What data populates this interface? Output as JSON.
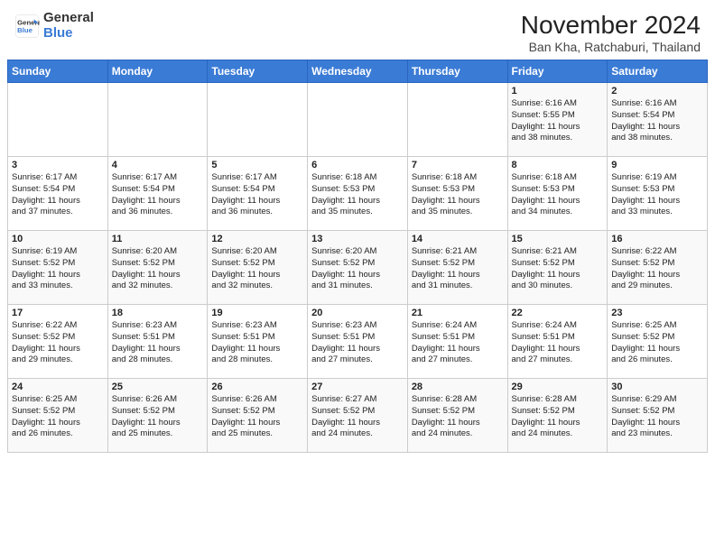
{
  "header": {
    "logo_general": "General",
    "logo_blue": "Blue",
    "month_title": "November 2024",
    "location": "Ban Kha, Ratchaburi, Thailand"
  },
  "weekdays": [
    "Sunday",
    "Monday",
    "Tuesday",
    "Wednesday",
    "Thursday",
    "Friday",
    "Saturday"
  ],
  "weeks": [
    [
      {
        "day": "",
        "info": ""
      },
      {
        "day": "",
        "info": ""
      },
      {
        "day": "",
        "info": ""
      },
      {
        "day": "",
        "info": ""
      },
      {
        "day": "",
        "info": ""
      },
      {
        "day": "1",
        "info": "Sunrise: 6:16 AM\nSunset: 5:55 PM\nDaylight: 11 hours\nand 38 minutes."
      },
      {
        "day": "2",
        "info": "Sunrise: 6:16 AM\nSunset: 5:54 PM\nDaylight: 11 hours\nand 38 minutes."
      }
    ],
    [
      {
        "day": "3",
        "info": "Sunrise: 6:17 AM\nSunset: 5:54 PM\nDaylight: 11 hours\nand 37 minutes."
      },
      {
        "day": "4",
        "info": "Sunrise: 6:17 AM\nSunset: 5:54 PM\nDaylight: 11 hours\nand 36 minutes."
      },
      {
        "day": "5",
        "info": "Sunrise: 6:17 AM\nSunset: 5:54 PM\nDaylight: 11 hours\nand 36 minutes."
      },
      {
        "day": "6",
        "info": "Sunrise: 6:18 AM\nSunset: 5:53 PM\nDaylight: 11 hours\nand 35 minutes."
      },
      {
        "day": "7",
        "info": "Sunrise: 6:18 AM\nSunset: 5:53 PM\nDaylight: 11 hours\nand 35 minutes."
      },
      {
        "day": "8",
        "info": "Sunrise: 6:18 AM\nSunset: 5:53 PM\nDaylight: 11 hours\nand 34 minutes."
      },
      {
        "day": "9",
        "info": "Sunrise: 6:19 AM\nSunset: 5:53 PM\nDaylight: 11 hours\nand 33 minutes."
      }
    ],
    [
      {
        "day": "10",
        "info": "Sunrise: 6:19 AM\nSunset: 5:52 PM\nDaylight: 11 hours\nand 33 minutes."
      },
      {
        "day": "11",
        "info": "Sunrise: 6:20 AM\nSunset: 5:52 PM\nDaylight: 11 hours\nand 32 minutes."
      },
      {
        "day": "12",
        "info": "Sunrise: 6:20 AM\nSunset: 5:52 PM\nDaylight: 11 hours\nand 32 minutes."
      },
      {
        "day": "13",
        "info": "Sunrise: 6:20 AM\nSunset: 5:52 PM\nDaylight: 11 hours\nand 31 minutes."
      },
      {
        "day": "14",
        "info": "Sunrise: 6:21 AM\nSunset: 5:52 PM\nDaylight: 11 hours\nand 31 minutes."
      },
      {
        "day": "15",
        "info": "Sunrise: 6:21 AM\nSunset: 5:52 PM\nDaylight: 11 hours\nand 30 minutes."
      },
      {
        "day": "16",
        "info": "Sunrise: 6:22 AM\nSunset: 5:52 PM\nDaylight: 11 hours\nand 29 minutes."
      }
    ],
    [
      {
        "day": "17",
        "info": "Sunrise: 6:22 AM\nSunset: 5:52 PM\nDaylight: 11 hours\nand 29 minutes."
      },
      {
        "day": "18",
        "info": "Sunrise: 6:23 AM\nSunset: 5:51 PM\nDaylight: 11 hours\nand 28 minutes."
      },
      {
        "day": "19",
        "info": "Sunrise: 6:23 AM\nSunset: 5:51 PM\nDaylight: 11 hours\nand 28 minutes."
      },
      {
        "day": "20",
        "info": "Sunrise: 6:23 AM\nSunset: 5:51 PM\nDaylight: 11 hours\nand 27 minutes."
      },
      {
        "day": "21",
        "info": "Sunrise: 6:24 AM\nSunset: 5:51 PM\nDaylight: 11 hours\nand 27 minutes."
      },
      {
        "day": "22",
        "info": "Sunrise: 6:24 AM\nSunset: 5:51 PM\nDaylight: 11 hours\nand 27 minutes."
      },
      {
        "day": "23",
        "info": "Sunrise: 6:25 AM\nSunset: 5:52 PM\nDaylight: 11 hours\nand 26 minutes."
      }
    ],
    [
      {
        "day": "24",
        "info": "Sunrise: 6:25 AM\nSunset: 5:52 PM\nDaylight: 11 hours\nand 26 minutes."
      },
      {
        "day": "25",
        "info": "Sunrise: 6:26 AM\nSunset: 5:52 PM\nDaylight: 11 hours\nand 25 minutes."
      },
      {
        "day": "26",
        "info": "Sunrise: 6:26 AM\nSunset: 5:52 PM\nDaylight: 11 hours\nand 25 minutes."
      },
      {
        "day": "27",
        "info": "Sunrise: 6:27 AM\nSunset: 5:52 PM\nDaylight: 11 hours\nand 24 minutes."
      },
      {
        "day": "28",
        "info": "Sunrise: 6:28 AM\nSunset: 5:52 PM\nDaylight: 11 hours\nand 24 minutes."
      },
      {
        "day": "29",
        "info": "Sunrise: 6:28 AM\nSunset: 5:52 PM\nDaylight: 11 hours\nand 24 minutes."
      },
      {
        "day": "30",
        "info": "Sunrise: 6:29 AM\nSunset: 5:52 PM\nDaylight: 11 hours\nand 23 minutes."
      }
    ]
  ]
}
